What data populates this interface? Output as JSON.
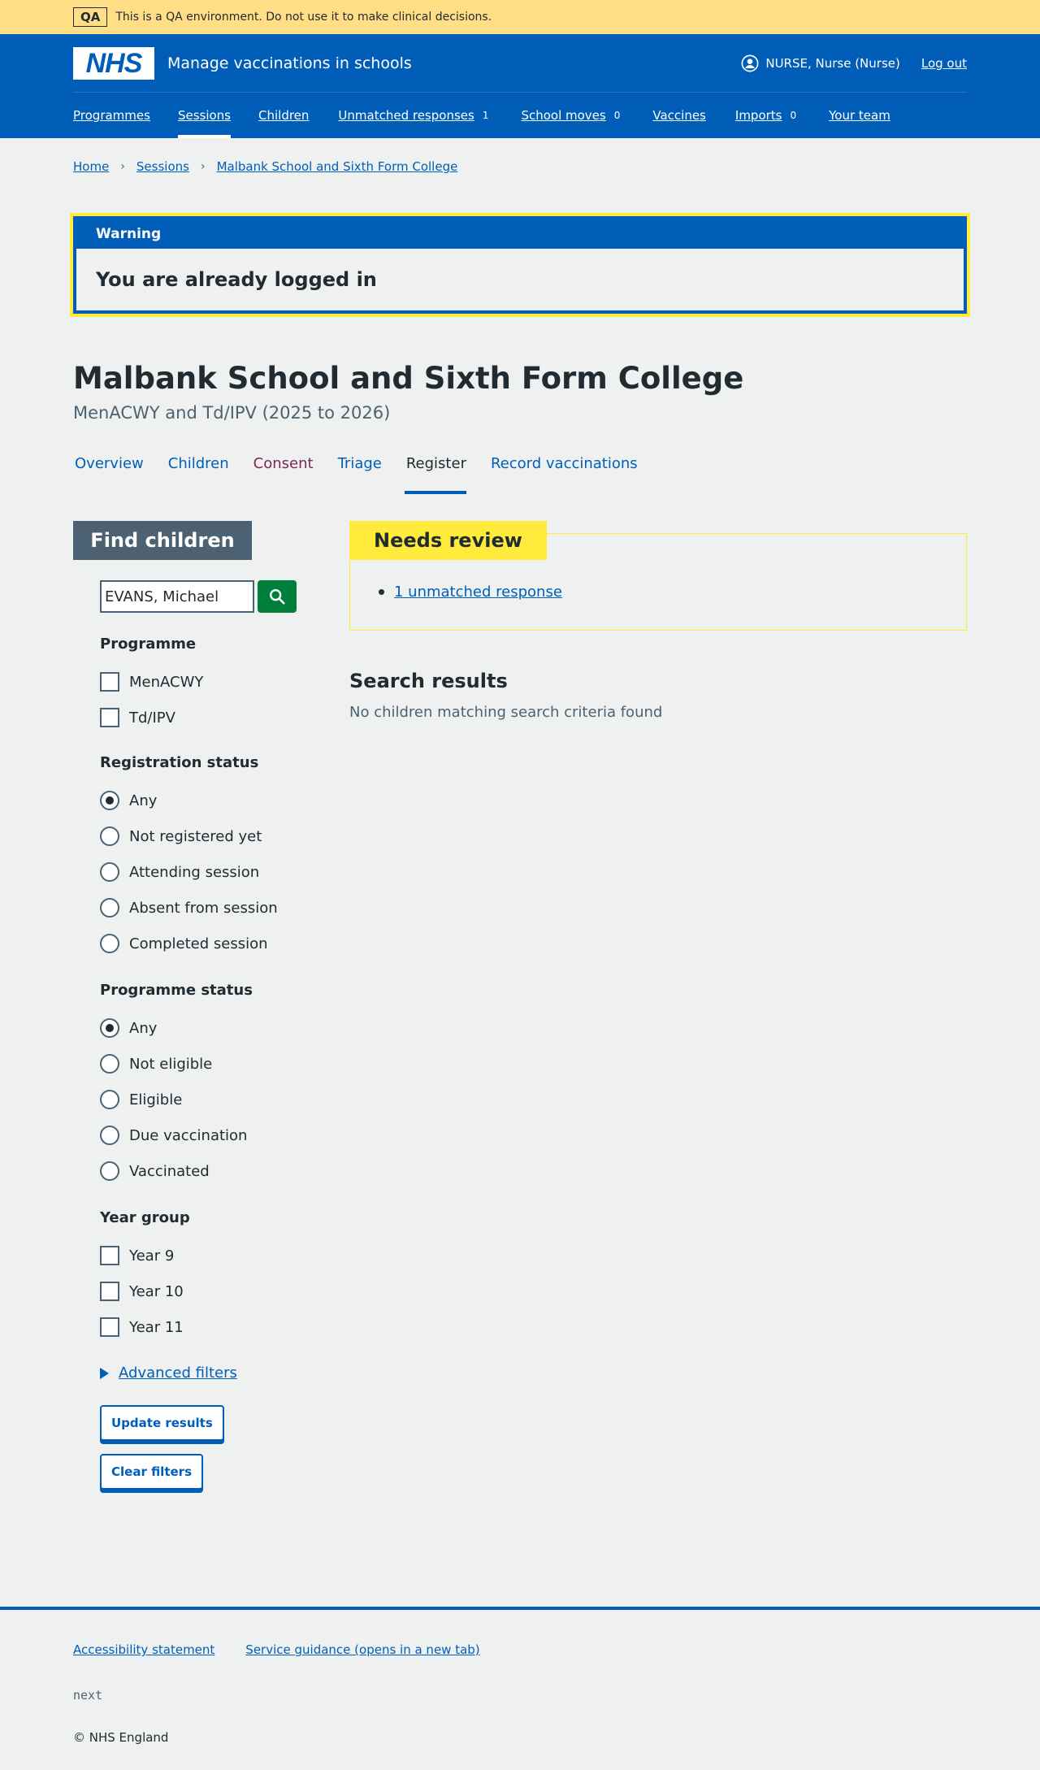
{
  "qa_banner": {
    "tag": "QA",
    "text": "This is a QA environment. Do not use it to make clinical decisions."
  },
  "header": {
    "logo": "NHS",
    "service_name": "Manage vaccinations in schools",
    "user_name": "NURSE, Nurse (Nurse)",
    "logout": "Log out",
    "nav": [
      {
        "label": "Programmes"
      },
      {
        "label": "Sessions",
        "active": true
      },
      {
        "label": "Children"
      },
      {
        "label": "Unmatched responses",
        "count": "1"
      },
      {
        "label": "School moves",
        "count": "0"
      },
      {
        "label": "Vaccines"
      },
      {
        "label": "Imports",
        "count": "0"
      },
      {
        "label": "Your team"
      }
    ]
  },
  "breadcrumb": [
    "Home",
    "Sessions",
    "Malbank School and Sixth Form College"
  ],
  "warning": {
    "heading": "Warning",
    "body": "You are already logged in"
  },
  "page": {
    "title": "Malbank School and Sixth Form College",
    "caption": "MenACWY and Td/IPV (2025 to 2026)"
  },
  "tabs": [
    "Overview",
    "Children",
    "Consent",
    "Triage",
    "Register",
    "Record vaccinations"
  ],
  "filters": {
    "heading": "Find children",
    "search_value": "EVANS, Michael",
    "programme": {
      "legend": "Programme",
      "options": [
        "MenACWY",
        "Td/IPV"
      ]
    },
    "registration": {
      "legend": "Registration status",
      "options": [
        "Any",
        "Not registered yet",
        "Attending session",
        "Absent from session",
        "Completed session"
      ],
      "selected": "Any"
    },
    "programme_status": {
      "legend": "Programme status",
      "options": [
        "Any",
        "Not eligible",
        "Eligible",
        "Due vaccination",
        "Vaccinated"
      ],
      "selected": "Any"
    },
    "year_group": {
      "legend": "Year group",
      "options": [
        "Year 9",
        "Year 10",
        "Year 11"
      ]
    },
    "advanced": "Advanced filters",
    "update": "Update results",
    "clear": "Clear filters"
  },
  "review": {
    "heading": "Needs review",
    "link": "1 unmatched response"
  },
  "results": {
    "title": "Search results",
    "text": "No children matching search criteria found"
  },
  "footer": {
    "links": [
      "Accessibility statement",
      "Service guidance (opens in a new tab)"
    ],
    "version": "next",
    "copyright": "© NHS England"
  },
  "colors": {
    "primary": "#005eb8",
    "qa_banner": "#ffde86",
    "warning_outline": "#ffeb3b",
    "search_button": "#007f3b",
    "consent_link": "#7c2855"
  }
}
